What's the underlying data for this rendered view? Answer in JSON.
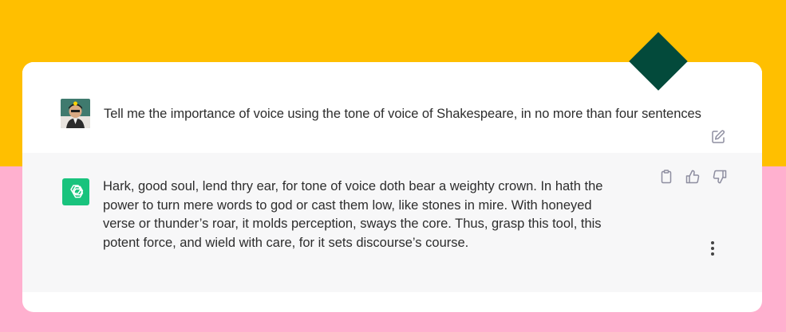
{
  "colors": {
    "background_top": "#FFBF00",
    "background_bottom": "#FFB0CF",
    "card": "#FFFFFF",
    "assistant_row": "#F7F7F8",
    "diamond": "#034A3B",
    "gpt_logo": "#19C37D",
    "icon_gray": "#8E8EA0"
  },
  "user_message": {
    "avatar_icon": "user-avatar",
    "text": "Tell me the importance of voice using the tone of voice of Shakespeare, in no more than four sentences",
    "edit_icon": "edit-icon"
  },
  "assistant_message": {
    "logo_icon": "openai-logo-icon",
    "text": "Hark, good soul, lend thry ear, for tone of voice doth bear a weighty crown. In hath the power to turn mere words to god or cast them low, like stones in mire. With honeyed verse or thunder’s roar, it molds perception, sways the core. Thus, grasp this tool, this potent force, and wield with care, for it sets discourse’s course.",
    "actions": [
      "clipboard-icon",
      "thumbs-up-icon",
      "thumbs-down-icon"
    ],
    "more_icon": "more-vertical-icon"
  }
}
